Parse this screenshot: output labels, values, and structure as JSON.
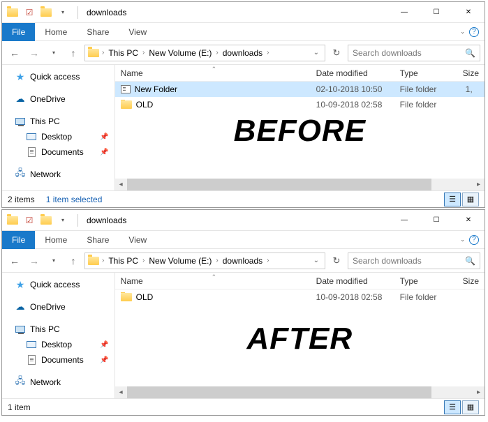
{
  "windows": [
    {
      "title": "downloads",
      "ribbon": {
        "file": "File",
        "tabs": [
          "Home",
          "Share",
          "View"
        ]
      },
      "breadcrumb": [
        "This PC",
        "New Volume (E:)",
        "downloads"
      ],
      "search_placeholder": "Search downloads",
      "sidebar": {
        "quick_access": "Quick access",
        "onedrive": "OneDrive",
        "this_pc": "This PC",
        "desktop": "Desktop",
        "documents": "Documents",
        "network": "Network"
      },
      "columns": {
        "name": "Name",
        "date": "Date modified",
        "type": "Type",
        "size": "Size"
      },
      "rows": [
        {
          "name": "New Folder",
          "date": "02-10-2018 10:50",
          "type": "File folder",
          "size": "1,",
          "selected": true,
          "editing": true
        },
        {
          "name": "OLD",
          "date": "10-09-2018 02:58",
          "type": "File folder",
          "size": "",
          "selected": false,
          "editing": false
        }
      ],
      "big_label": "BEFORE",
      "status": {
        "count": "2 items",
        "selection": "1 item selected"
      }
    },
    {
      "title": "downloads",
      "ribbon": {
        "file": "File",
        "tabs": [
          "Home",
          "Share",
          "View"
        ]
      },
      "breadcrumb": [
        "This PC",
        "New Volume (E:)",
        "downloads"
      ],
      "search_placeholder": "Search downloads",
      "sidebar": {
        "quick_access": "Quick access",
        "onedrive": "OneDrive",
        "this_pc": "This PC",
        "desktop": "Desktop",
        "documents": "Documents",
        "network": "Network"
      },
      "columns": {
        "name": "Name",
        "date": "Date modified",
        "type": "Type",
        "size": "Size"
      },
      "rows": [
        {
          "name": "OLD",
          "date": "10-09-2018 02:58",
          "type": "File folder",
          "size": "",
          "selected": false,
          "editing": false
        }
      ],
      "big_label": "AFTER",
      "status": {
        "count": "1 item",
        "selection": ""
      }
    }
  ]
}
